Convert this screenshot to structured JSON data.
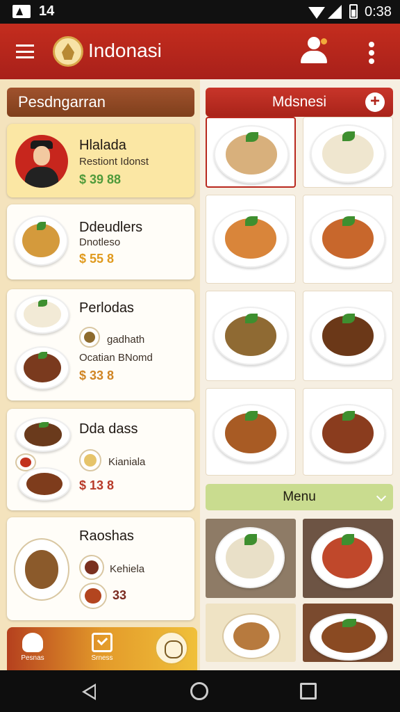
{
  "status_bar": {
    "time_left": "14",
    "time_right": "0:38"
  },
  "app_bar": {
    "title": "Indonasi"
  },
  "left_panel": {
    "header": "Pesdngarran",
    "cards": [
      {
        "name": "Hlalada",
        "sub": "Restiont Idonst",
        "price": "$ 39 88"
      },
      {
        "name": "Ddeudlers",
        "sub": "Dnotleso",
        "price": "$ 55 8"
      },
      {
        "name": "Perlodas",
        "sub": "gadhath",
        "sub2": "Ocatian BNomd",
        "price": "$ 33 8"
      },
      {
        "name": "Dda dass",
        "sub": "Kianiala",
        "price": "$ 13 8"
      },
      {
        "name": "Raoshas",
        "sub": "Kehiela",
        "price": "33"
      }
    ]
  },
  "right_panel": {
    "header": "Mdsnesi",
    "menu_label": "Menu"
  },
  "bottom_nav": {
    "item1": "Pesnas",
    "item2": "Srness"
  },
  "colors": {
    "brand_red": "#c42d1e",
    "accent_yellow": "#fbe7a4",
    "menu_green": "#c9dc8f"
  }
}
